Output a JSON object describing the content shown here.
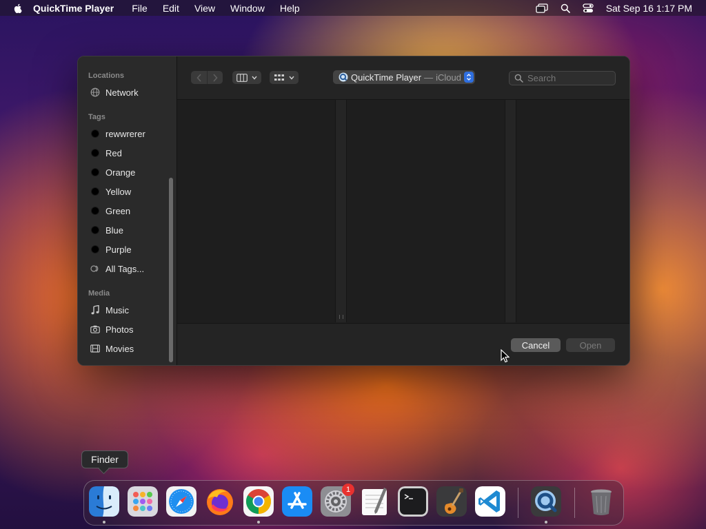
{
  "menubar": {
    "app_name": "QuickTime Player",
    "menus": [
      "File",
      "Edit",
      "View",
      "Window",
      "Help"
    ],
    "datetime": "Sat Sep 16  1:17 PM"
  },
  "dialog": {
    "sidebar": {
      "locations_heading": "Locations",
      "locations": [
        {
          "label": "Network",
          "icon": "globe-icon"
        }
      ],
      "tags_heading": "Tags",
      "tags": [
        "rewwrerer",
        "Red",
        "Orange",
        "Yellow",
        "Green",
        "Blue",
        "Purple"
      ],
      "all_tags_label": "All Tags...",
      "media_heading": "Media",
      "media": [
        {
          "label": "Music",
          "icon": "music-note-icon"
        },
        {
          "label": "Photos",
          "icon": "camera-icon"
        },
        {
          "label": "Movies",
          "icon": "film-icon"
        }
      ]
    },
    "toolbar": {
      "location_title": "QuickTime Player",
      "location_separator": "—",
      "location_sub": "iCloud",
      "search_placeholder": "Search"
    },
    "footer": {
      "cancel_label": "Cancel",
      "open_label": "Open"
    }
  },
  "tooltip": {
    "label": "Finder"
  },
  "dock": {
    "apps": [
      "Finder",
      "Launchpad",
      "Safari",
      "Firefox",
      "Chrome",
      "App Store",
      "System Settings",
      "TextEdit",
      "Terminal",
      "GarageBand",
      "VS Code",
      "QuickTime Player",
      "Trash"
    ],
    "settings_badge": "1"
  },
  "colors": {
    "accent": "#2f6fe0",
    "dialog_bg": "#1e1e1e",
    "sidebar_bg": "#2a2a2a"
  }
}
